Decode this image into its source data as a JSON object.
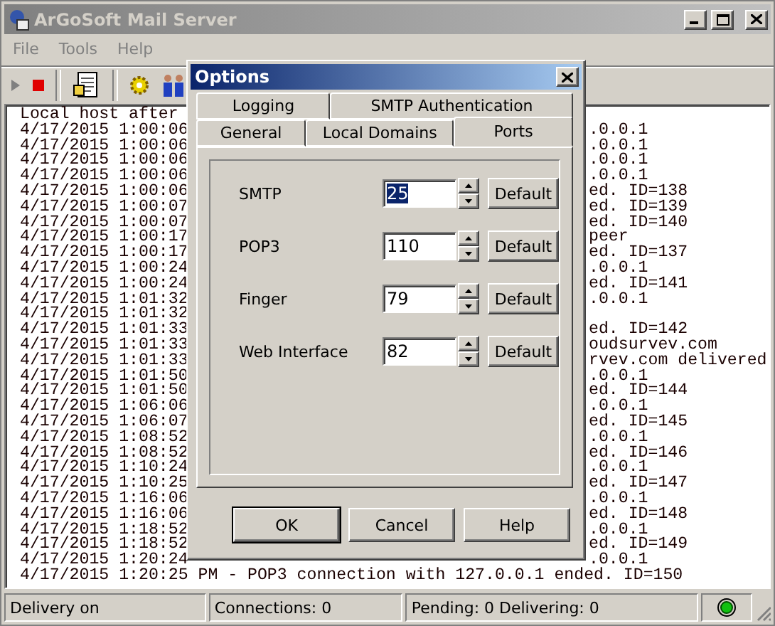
{
  "window": {
    "title": "ArGoSoft Mail Server"
  },
  "menu": [
    "File",
    "Tools",
    "Help"
  ],
  "log": [
    {
      "left": "Local host after"
    },
    {
      "left": "4/17/2015 1:00:06",
      "right": ".0.0.1"
    },
    {
      "left": "4/17/2015 1:00:06",
      "right": ".0.0.1"
    },
    {
      "left": "4/17/2015 1:00:06",
      "right": ".0.0.1"
    },
    {
      "left": "4/17/2015 1:00:06",
      "right": ".0.0.1"
    },
    {
      "left": "4/17/2015 1:00:06",
      "right": "ed. ID=138"
    },
    {
      "left": "4/17/2015 1:00:07",
      "right": "ed. ID=139"
    },
    {
      "left": "4/17/2015 1:00:07",
      "right": "ed. ID=140"
    },
    {
      "left": "4/17/2015 1:00:17",
      "right": "peer"
    },
    {
      "left": "4/17/2015 1:00:17",
      "right": "ed. ID=137"
    },
    {
      "left": "4/17/2015 1:00:24",
      "right": ".0.0.1"
    },
    {
      "left": "4/17/2015 1:00:24",
      "right": "ed. ID=141"
    },
    {
      "left": "4/17/2015 1:01:32",
      "right": ".0.0.1"
    },
    {
      "left": "4/17/2015 1:01:32"
    },
    {
      "left": "4/17/2015 1:01:33",
      "right": "ed. ID=142"
    },
    {
      "left": "4/17/2015 1:01:33",
      "right": "oudsurvev.com"
    },
    {
      "left": "4/17/2015 1:01:33",
      "right": "rvev.com delivered"
    },
    {
      "left": "4/17/2015 1:01:50",
      "right": ".0.0.1"
    },
    {
      "left": "4/17/2015 1:01:50",
      "right": "ed. ID=144"
    },
    {
      "left": "4/17/2015 1:06:06",
      "right": ".0.0.1"
    },
    {
      "left": "4/17/2015 1:06:07",
      "right": "ed. ID=145"
    },
    {
      "left": "4/17/2015 1:08:52",
      "right": ".0.0.1"
    },
    {
      "left": "4/17/2015 1:08:52",
      "right": "ed. ID=146"
    },
    {
      "left": "4/17/2015 1:10:24",
      "right": ".0.0.1"
    },
    {
      "left": "4/17/2015 1:10:25",
      "right": "ed. ID=147"
    },
    {
      "left": "4/17/2015 1:16:06",
      "right": ".0.0.1"
    },
    {
      "left": "4/17/2015 1:16:06",
      "right": "ed. ID=148"
    },
    {
      "left": "4/17/2015 1:18:52",
      "right": ".0.0.1"
    },
    {
      "left": "4/17/2015 1:18:52",
      "right": "ed. ID=149"
    },
    {
      "left": "4/17/2015 1:20:24",
      "right": ".0.0.1"
    },
    {
      "text": "4/17/2015 1:20:25 PM - POP3 connection with 127.0.0.1 ended. ID=150"
    }
  ],
  "status_bar": [
    "Delivery on",
    "Connections: 0",
    "Pending: 0  Delivering: 0"
  ],
  "dialog": {
    "title": "Options",
    "tab_rows": [
      [
        {
          "label": "Logging",
          "selected": false
        },
        {
          "label": "SMTP Authentication",
          "selected": false
        }
      ],
      [
        {
          "label": "General",
          "selected": false
        },
        {
          "label": "Local Domains",
          "selected": false
        },
        {
          "label": "Ports",
          "selected": true
        }
      ]
    ],
    "ports": [
      {
        "label": "SMTP",
        "value": "25",
        "selected": true,
        "button": "Default"
      },
      {
        "label": "POP3",
        "value": "110",
        "selected": false,
        "button": "Default"
      },
      {
        "label": "Finger",
        "value": "79",
        "selected": false,
        "button": "Default"
      },
      {
        "label": "Web Interface",
        "value": "82",
        "selected": false,
        "button": "Default"
      }
    ],
    "buttons": [
      {
        "label": "OK",
        "default": true
      },
      {
        "label": "Cancel",
        "default": false
      },
      {
        "label": "Help",
        "default": false
      }
    ]
  }
}
